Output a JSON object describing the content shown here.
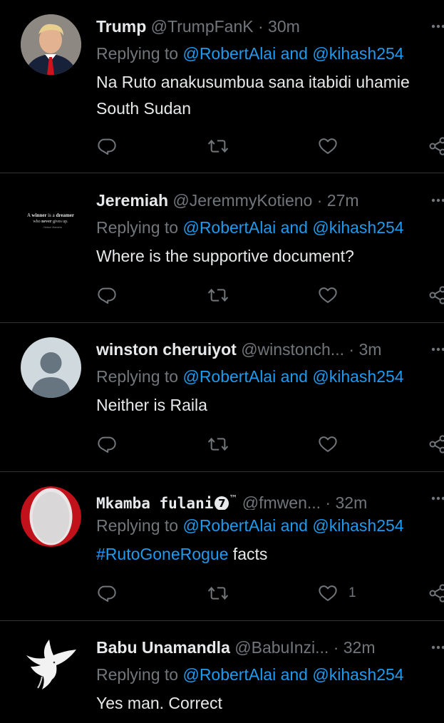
{
  "tweets": [
    {
      "name": "Trump",
      "handle": "@TrumpFanK",
      "dot": "·",
      "time": "30m",
      "reply_prefix": "Replying to ",
      "reply_mentions": "@RobertAlai and @kihash254",
      "body": "Na Ruto anakusumbua sana itabidi uhamie South Sudan",
      "like_count": "",
      "avatar": "portrait-suit-red-tie"
    },
    {
      "name": "Jeremiah",
      "handle": "@JeremmyKotieno",
      "dot": "·",
      "time": "27m",
      "reply_prefix": "Replying to ",
      "reply_mentions": "@RobertAlai and @kihash254",
      "body": "Where is the supportive document?",
      "like_count": "",
      "avatar": "quote-image",
      "avatar_quote": {
        "line1_a": "A ",
        "line1_b": "winner",
        "line1_c": " is a ",
        "line1_d": "dreamer",
        "line2_a": "who ",
        "line2_b": "never",
        "line2_c": " gives up.",
        "line3": "- Nelson Mandela"
      }
    },
    {
      "name": "winston cheruiyot",
      "handle": "@winstonch...",
      "dot": "·",
      "time": "3m",
      "reply_prefix": "Replying to ",
      "reply_mentions": "@RobertAlai and @kihash254",
      "body": "Neither is Raila",
      "like_count": "",
      "avatar": "default-profile"
    },
    {
      "name": "Mkamba fulani",
      "badge": "7",
      "tm": "™",
      "handle": "@fmwen...",
      "dot": "·",
      "time": "32m",
      "reply_prefix": "Replying to ",
      "reply_mentions": "@RobertAlai and @kihash254",
      "hashtag": "#RutoGoneRogue",
      "body_rest": " facts",
      "like_count": "1",
      "avatar": "red-ring-oval"
    },
    {
      "name": "Babu Unamandla",
      "handle": "@BabuInzi...",
      "dot": "·",
      "time": "32m",
      "reply_prefix": "Replying to ",
      "reply_mentions": "@RobertAlai and @kihash254",
      "body": "Yes man. Correct",
      "like_count": "",
      "avatar": "white-dove"
    }
  ],
  "colors": {
    "background": "#000000",
    "text": "#e7e9ea",
    "secondary": "#71767b",
    "link": "#1d9bf0",
    "divider": "#2f3336"
  },
  "icons": {
    "reply": "reply-icon",
    "retweet": "retweet-icon",
    "like": "heart-icon",
    "share": "share-icon",
    "more": "more-icon"
  }
}
